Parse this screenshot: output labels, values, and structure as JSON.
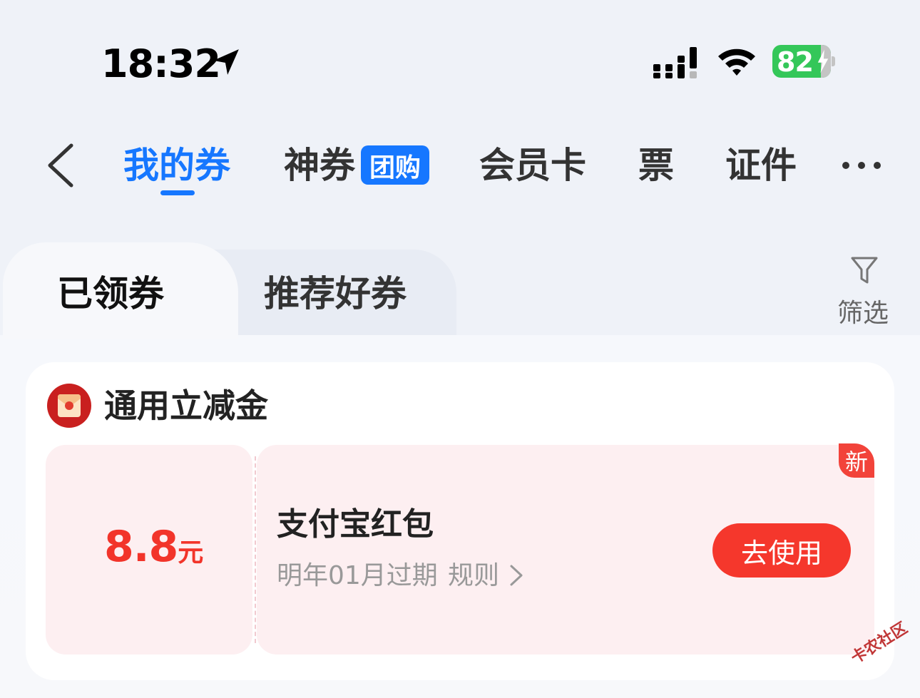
{
  "status_bar": {
    "time": "18:32",
    "battery_level": "82"
  },
  "nav": {
    "tabs": [
      {
        "label": "我的券",
        "active": true
      },
      {
        "label": "神券",
        "badge": "团购"
      },
      {
        "label": "会员卡"
      },
      {
        "label": "票"
      },
      {
        "label": "证件"
      }
    ]
  },
  "subtabs": [
    {
      "label": "已领券",
      "active": true
    },
    {
      "label": "推荐好券"
    }
  ],
  "filter_label": "筛选",
  "section": {
    "title": "通用立减金",
    "coupon": {
      "amount": "8.8",
      "unit": "元",
      "name": "支付宝红包",
      "expiry": "明年01月过期",
      "rules_label": "规则",
      "button_label": "去使用",
      "badge": "新"
    }
  },
  "watermark": "卡农社区",
  "colors": {
    "accent": "#1677ff",
    "red": "#f5372c",
    "coupon_bg": "#fdeff1",
    "battery": "#34c759"
  }
}
